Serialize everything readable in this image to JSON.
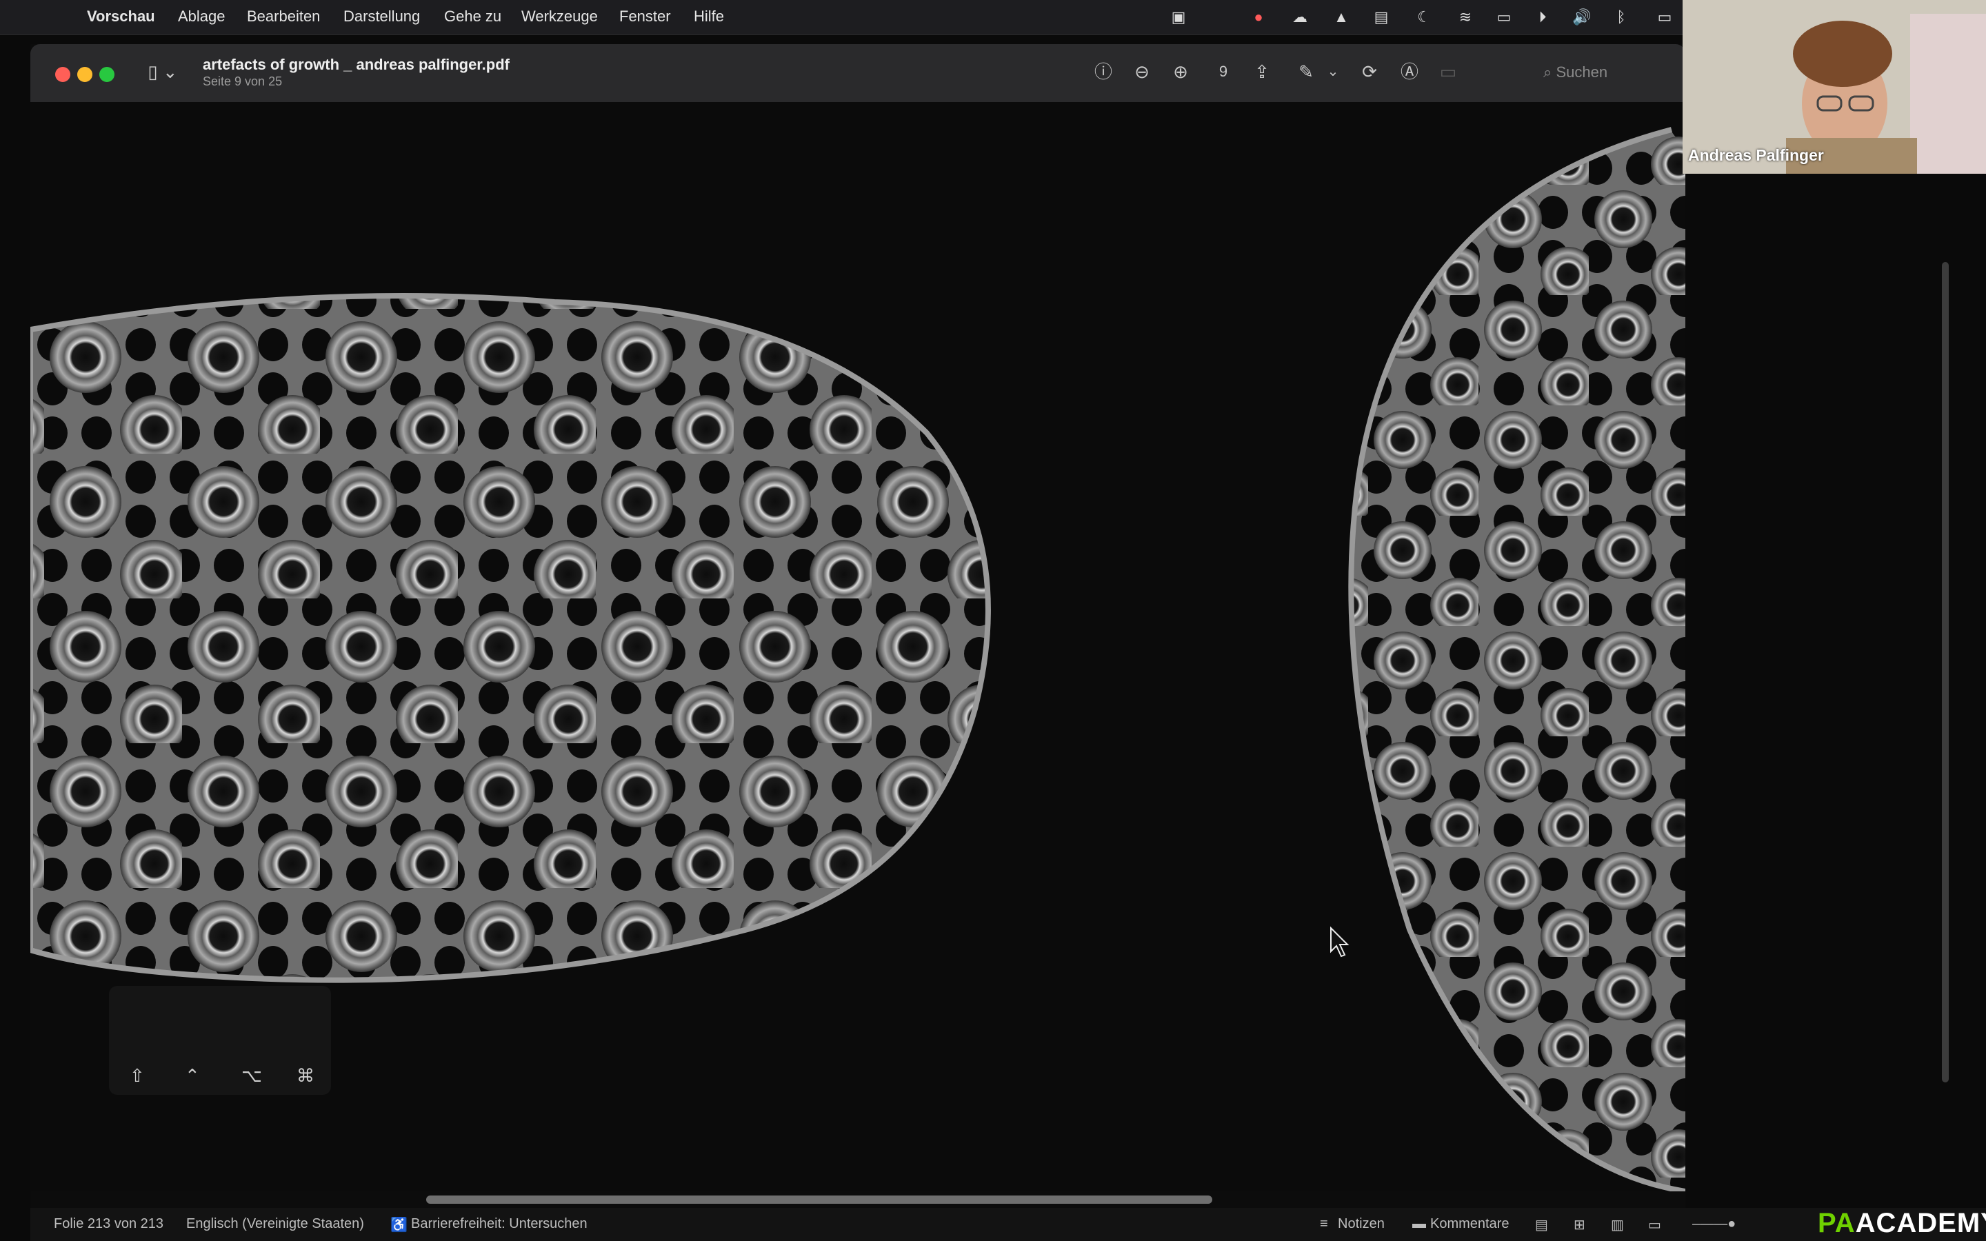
{
  "menubar": {
    "app_name": "Vorschau",
    "items": [
      "Ablage",
      "Bearbeiten",
      "Darstellung",
      "Gehe zu",
      "Werkzeuge",
      "Fenster",
      "Hilfe"
    ]
  },
  "window": {
    "document_title": "artefacts of growth _ andreas palfinger.pdf",
    "page_info": "Seite 9 von 25",
    "page_number": "9",
    "search_placeholder": "Suchen"
  },
  "keyboard_overlay": {
    "keys": [
      "⇧",
      "⌃",
      "⌥",
      "⌘"
    ]
  },
  "statusbar": {
    "slide_info": "Folie 213 von 213",
    "language": "Englisch (Vereinigte Staaten)",
    "accessibility": "Barrierefreiheit: Untersuchen",
    "notes": "Notizen",
    "comments": "Kommentare"
  },
  "camera": {
    "participant_name": "Andreas Palfinger"
  },
  "brand": {
    "text_a": "PA",
    "text_b": "ACADEMY"
  },
  "colors": {
    "close": "#ff5f57",
    "minimize": "#febc2e",
    "zoom": "#28c840",
    "brand_green": "#6fd200"
  }
}
